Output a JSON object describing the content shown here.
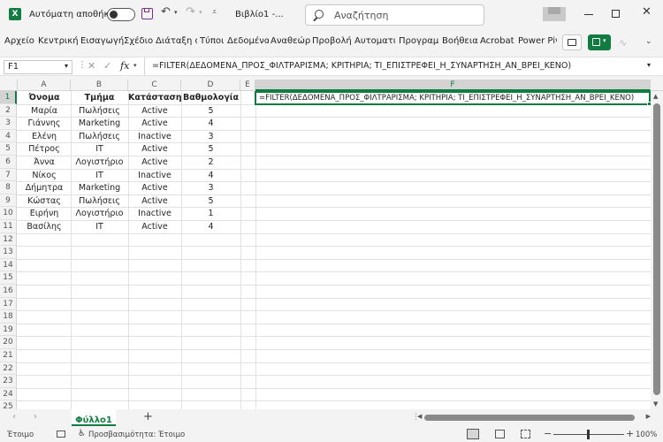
{
  "title_bar": {
    "autosave_label": "Αυτόματη αποθήκευση",
    "file_name": "Βιβλίο1 -...",
    "search_placeholder": "Αναζήτηση"
  },
  "ribbon_tabs": [
    "Αρχείο",
    "Κεντρική",
    "Εισαγωγή",
    "Σχέδιο",
    "Διάταξη σ",
    "Τύποι",
    "Δεδομένα",
    "Αναθεώρη",
    "Προβολή",
    "Αυτοματισ",
    "Προγραμμ",
    "Βοήθεια",
    "Acrobat",
    "Power Pivo"
  ],
  "formula_bar": {
    "name_box": "F1",
    "fx": "fx",
    "formula": "=FILTER(ΔΕΔΟΜΕΝΑ_ΠΡΟΣ_ΦΙΛΤΡΑΡΙΣΜΑ; ΚΡΙΤΗΡΙΑ; ΤΙ_ΕΠΙΣΤΡΕΦΕΙ_Η_ΣΥΝΑΡΤΗΣΗ_ΑΝ_ΒΡΕΙ_ΚΕΝΟ)"
  },
  "grid": {
    "columns": [
      "A",
      "B",
      "C",
      "D",
      "E",
      "F"
    ],
    "row_numbers": [
      "1",
      "2",
      "3",
      "4",
      "5",
      "6",
      "7",
      "8",
      "9",
      "10",
      "11",
      "12",
      "13",
      "14",
      "15",
      "16",
      "17",
      "18",
      "19",
      "20",
      "21",
      "22",
      "23",
      "24",
      "25"
    ],
    "headers": [
      "Όνομα",
      "Τμήμα",
      "Κατάσταση",
      "Βαθμολογία"
    ],
    "rows": [
      [
        "Μαρία",
        "Πωλήσεις",
        "Active",
        "5"
      ],
      [
        "Γιάννης",
        "Marketing",
        "Active",
        "4"
      ],
      [
        "Ελένη",
        "Πωλήσεις",
        "Inactive",
        "3"
      ],
      [
        "Πέτρος",
        "IT",
        "Active",
        "5"
      ],
      [
        "Άννα",
        "Λογιστήριο",
        "Active",
        "2"
      ],
      [
        "Νίκος",
        "IT",
        "Inactive",
        "4"
      ],
      [
        "Δήμητρα",
        "Marketing",
        "Active",
        "3"
      ],
      [
        "Κώστας",
        "Πωλήσεις",
        "Active",
        "5"
      ],
      [
        "Ειρήνη",
        "Λογιστήριο",
        "Inactive",
        "1"
      ],
      [
        "Βασίλης",
        "IT",
        "Active",
        "4"
      ]
    ],
    "active_cell_text": "=FILTER(ΔΕΔΟΜΕΝΑ_ΠΡΟΣ_ΦΙΛΤΡΑΡΙΣΜΑ; ΚΡΙΤΗΡΙΑ; ΤΙ_ΕΠΙΣΤΡΕΦΕΙ_Η_ΣΥΝΑΡΤΗΣΗ_ΑΝ_ΒΡΕΙ_ΚΕΝΟ)"
  },
  "sheet_tabs": {
    "active": "Φύλλο1"
  },
  "status_bar": {
    "ready": "Έτοιμο",
    "accessibility": "Προσβασιμότητα: Έτοιμο",
    "zoom": "100%"
  },
  "colors": {
    "excel_green": "#107c41",
    "accent_green": "#217346"
  }
}
